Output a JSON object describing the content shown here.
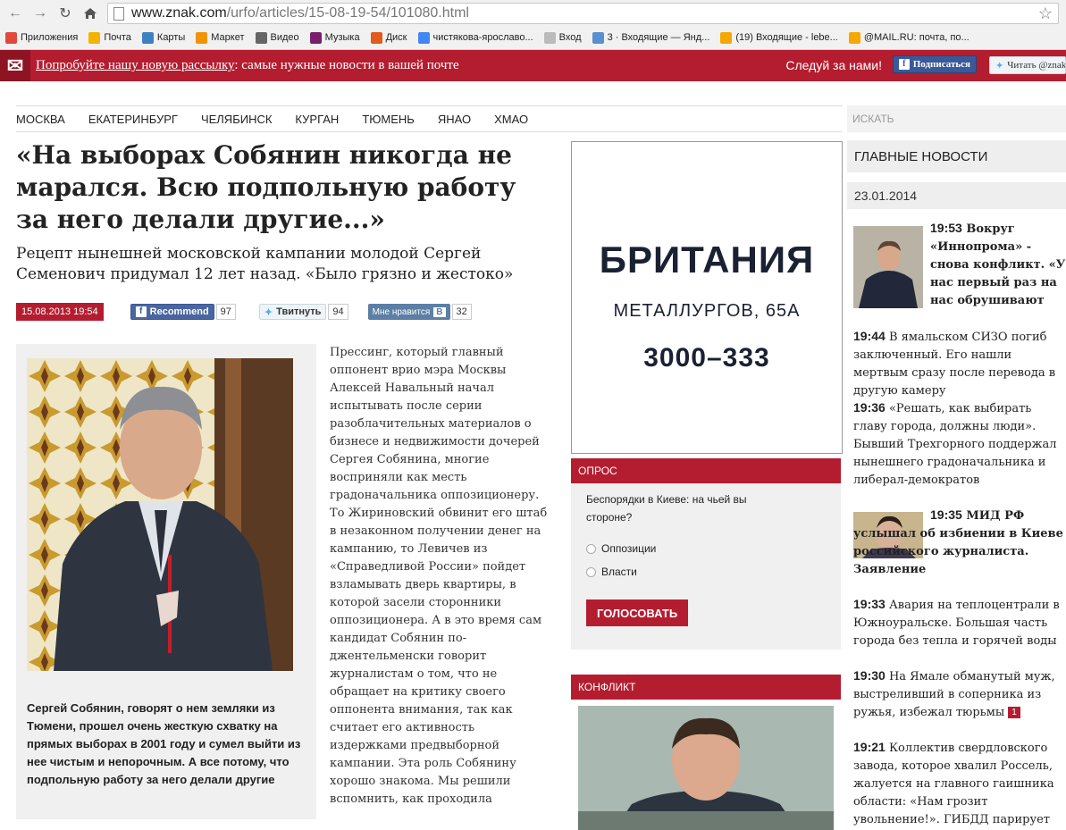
{
  "browser": {
    "url_host": "www.znak.com",
    "url_path": "/urfo/articles/15-08-19-54/101080.html",
    "bookmarks": [
      {
        "label": "Приложения",
        "icon": "apps-grid-icon",
        "color": "#e04a3b"
      },
      {
        "label": "Почта",
        "icon": "mail-icon",
        "color": "#f2b400"
      },
      {
        "label": "Карты",
        "icon": "maps-icon",
        "color": "#3b82c4"
      },
      {
        "label": "Маркет",
        "icon": "market-icon",
        "color": "#f29400"
      },
      {
        "label": "Видео",
        "icon": "video-icon",
        "color": "#666666"
      },
      {
        "label": "Музыка",
        "icon": "music-icon",
        "color": "#7b1f6d"
      },
      {
        "label": "Диск",
        "icon": "disk-icon",
        "color": "#e25a1c"
      },
      {
        "label": "чистякова-ярославо...",
        "icon": "google-icon",
        "color": "#4285f4"
      },
      {
        "label": "Вход",
        "icon": "page-icon",
        "color": "#bbbbbb"
      },
      {
        "label": "3 · Входящие — Янд...",
        "icon": "inbox-icon",
        "color": "#5a8fd0"
      },
      {
        "label": "(19) Входящие - lebe...",
        "icon": "mailru-icon",
        "color": "#f7a800"
      },
      {
        "label": "@MAIL.RU: почта, по...",
        "icon": "mailru-icon",
        "color": "#f7a800"
      }
    ]
  },
  "promo": {
    "link_text": "Попробуйте нашу новую рассылку",
    "rest_text": ": самые нужные новости в вашей почте",
    "follow_text": "Следуй за нами!",
    "fb_button": "Подписаться",
    "tw_button": "Читать @znak"
  },
  "cities": [
    "МОСКВА",
    "ЕКАТЕРИНБУРГ",
    "ЧЕЛЯБИНСК",
    "КУРГАН",
    "ТЮМЕНЬ",
    "ЯНАО",
    "ХМАО"
  ],
  "search_placeholder": "ИСКАТЬ",
  "article": {
    "title": "«На выборах Собянин никогда не марался. Всю подпольную работу за него делали другие...»",
    "lead": "Рецепт нынешней московской кампании молодой Сергей Семенович придумал 12 лет назад. «Было грязно и жестоко»",
    "date": "15.08.2013 19:54",
    "fb_label": "Recommend",
    "fb_count": "97",
    "tw_label": "Твитнуть",
    "tw_count": "94",
    "vk_label": "Мне нравится",
    "vk_count": "32",
    "caption": "Сергей Собянин, говорят о нем земляки из Тюмени, прошел очень жесткую схватку на прямых выборах в 2001 году и сумел выйти из нее чистым и непорочным. А все потому, что подпольную работу за него делали другие",
    "body": "Прессинг, который главный оппонент врио мэра Москвы Алексей Навальный начал испытывать после серии разоблачительных материалов о бизнесе и недвижимости дочерей Сергея Собянина, многие восприняли как месть градоначальника оппозиционеру. То Жириновский обвинит его штаб в незаконном получении денег на кампанию, то Левичев из «Справедливой России» пойдет взламывать дверь квартиры, в которой засели сторонники оппозиционера. А в это время сам кандидат Собянин по-джентельменски говорит журналистам о том, что не обращает на критику своего оппонента внимания, так как считает его активность издержками предвыборной кампании. Эта роль Собянину хорошо знакома. Мы решили вспомнить, как проходила"
  },
  "ad": {
    "line1": "БРИТАНИЯ",
    "line2": "МЕТАЛЛУРГОВ, 65А",
    "line3": "3000–333"
  },
  "poll": {
    "header": "ОПРОС",
    "question": "Беспорядки в Киеве: на чьей вы стороне?",
    "options": [
      "Оппозиции",
      "Власти"
    ],
    "vote_label": "ГОЛОСОВАТЬ"
  },
  "conflict": {
    "header": "КОНФЛИКТ"
  },
  "sidebar": {
    "header": "ГЛАВНЫЕ НОВОСТИ",
    "date": "23.01.2014",
    "news": [
      {
        "time": "19:53",
        "text": "Вокруг «Иннопрома» - снова конфликт. «У нас первый раз на нас обрушивают странные по содержанию иски»"
      },
      {
        "time": "19:44",
        "text": "В ямальском СИЗО погиб заключенный. Его нашли мертвым сразу после перевода в другую камеру"
      },
      {
        "time": "19:36",
        "text": "«Решать, как выбирать главу города, должны люди». Бывший Трехгорного поддержал нынешнего градоначальника и либерал-демократов"
      },
      {
        "time": "19:35",
        "text": "МИД РФ услышал об избиении в Киеве российского журналиста. Заявление"
      },
      {
        "time": "19:33",
        "text": "Авария на теплоцентрали в Южноуральске. Большая часть города без тепла и горячей воды"
      },
      {
        "time": "19:30",
        "text": "На Ямале обманутый муж, выстреливший в соперника из ружья, избежал тюрьмы",
        "badge": "1"
      },
      {
        "time": "19:21",
        "text": "Коллектив свердловского завода, которое хвалил Россель, жалуется на главного гаишника области: «Нам грозит увольнение!». ГИБДД парирует"
      }
    ]
  }
}
